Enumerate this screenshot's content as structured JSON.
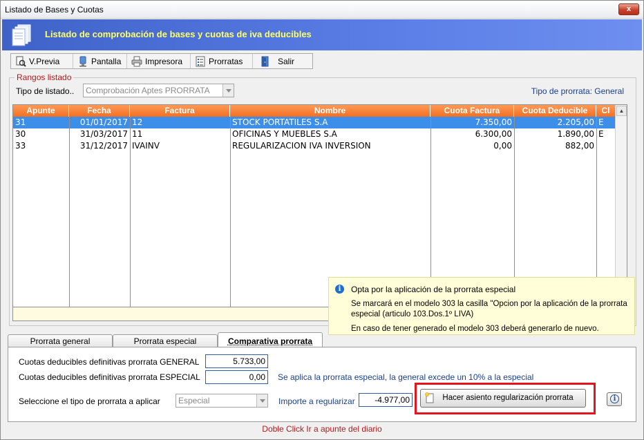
{
  "window": {
    "title": "Listado de Bases y Cuotas",
    "close_label": "x"
  },
  "banner": {
    "title": "Listado de comprobación de bases y cuotas de iva deducibles"
  },
  "toolbar": {
    "items": [
      {
        "label": "V.Previa",
        "icon": "preview-icon"
      },
      {
        "label": "Pantalla",
        "icon": "screen-icon"
      },
      {
        "label": "Impresora",
        "icon": "printer-icon"
      },
      {
        "label": "Prorratas",
        "icon": "list-icon"
      },
      {
        "label": "Salir",
        "icon": "exit-icon"
      }
    ]
  },
  "rangos": {
    "legend": "Rangos listado",
    "tipo_listado_label": "Tipo de listado..",
    "tipo_listado_value": "Comprobación Aptes PRORRATA",
    "tipo_prorrata": "Tipo de prorrata: General"
  },
  "grid": {
    "columns": [
      "Apunte",
      "Fecha",
      "Factura",
      "Nombre",
      "Cuota Factura",
      "Cuota Deducible",
      "Cl"
    ],
    "rows": [
      {
        "apunte": "31",
        "fecha": "01/01/2017",
        "factura": "12",
        "nombre": "STOCK PORTATILES S.A",
        "cuota_factura": "7.350,00",
        "cuota_deducible": "2.205,00",
        "cl": "E",
        "selected": true
      },
      {
        "apunte": "30",
        "fecha": "31/03/2017",
        "factura": "11",
        "nombre": "OFICINAS Y MUEBLES S.A",
        "cuota_factura": "6.300,00",
        "cuota_deducible": "1.890,00",
        "cl": "E",
        "selected": false
      },
      {
        "apunte": "33",
        "fecha": "31/12/2017",
        "factura": "IVAINV",
        "nombre": "REGULARIZACION IVA INVERSION",
        "cuota_factura": "0,00",
        "cuota_deducible": "882,00",
        "cl": "",
        "selected": false
      }
    ]
  },
  "tooltip": {
    "title": "Opta por la aplicación de la prorrata especial",
    "line2": "Se marcará en el modelo 303 la casilla \"Opcion por la aplicación de la prorrata especial (articulo 103.Dos.1º LIVA)",
    "line3": "En caso de tener generado el modelo 303 deberá generarlo de nuevo."
  },
  "tabs": [
    "Prorrata general",
    "Prorrata especial",
    "Comparativa prorrata"
  ],
  "active_tab": "Comparativa prorrata",
  "comparativa": {
    "general_label": "Cuotas deducibles definitivas prorrata GENERAL",
    "general_value": "5.733,00",
    "especial_label": "Cuotas deducibles definitivas prorrata ESPECIAL",
    "especial_value": "0,00",
    "note": "Se aplica la prorrata especial, la general excede un 10% a la especial",
    "select_label": "Seleccione el tipo de prorrata a aplicar",
    "select_value": "Especial",
    "importe_label": "Importe a regularizar",
    "importe_value": "-4.977,00",
    "button_label": "Hacer asiento regularización prorrata"
  },
  "status": "Doble Click Ir a apunte del diario",
  "colors": {
    "accent_header": "#f26f22",
    "banner": "#4a6fd8",
    "selected_row": "#3d8ee8",
    "highlight": "#e3141b"
  }
}
